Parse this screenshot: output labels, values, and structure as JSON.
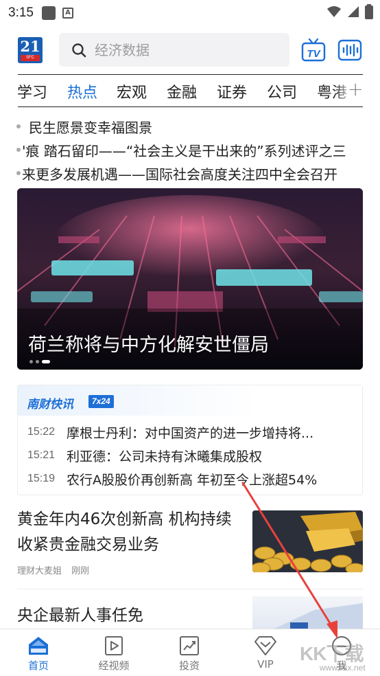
{
  "status_bar": {
    "time": "3:15"
  },
  "header": {
    "logo_number": "21",
    "logo_sub": "SFC",
    "search_placeholder": "经济数据"
  },
  "tabs": [
    "学习",
    "热点",
    "宏观",
    "金融",
    "证券",
    "公司",
    "粤港"
  ],
  "active_tab": "热点",
  "ticker": [
    "民生愿景变幸福图景",
    "'痕 踏石留印——“社会主义是干出来的”系列述评之三",
    "来更多发展机遇——国际社会高度关注四中全会召开"
  ],
  "banner": {
    "caption": "荷兰称将与中方化解安世僵局",
    "slide_count": 3,
    "active_slide": 3
  },
  "express": {
    "title": "南财快讯",
    "badge": "7x24",
    "items": [
      {
        "time": "15:22",
        "text": "摩根士丹利：对中国资产的进一步增持将..."
      },
      {
        "time": "15:21",
        "text": "利亚德：公司未持有沐曦集成股权"
      },
      {
        "time": "15:19",
        "text": "农行A股股价再创新高 年初至今上涨超54%"
      }
    ]
  },
  "article1": {
    "title": "黄金年内46次创新高 机构持续收紧贵金融交易业务",
    "source": "理财大麦姐",
    "time": "刚刚"
  },
  "article2": {
    "title": "央企最新人事任免"
  },
  "bottom_nav": [
    {
      "label": "首页",
      "icon": "home-icon",
      "active": true
    },
    {
      "label": "经视频",
      "icon": "video-play-icon",
      "active": false
    },
    {
      "label": "投资",
      "icon": "chart-trend-icon",
      "active": false
    },
    {
      "label": "VIP",
      "icon": "vip-diamond-icon",
      "active": false
    },
    {
      "label": "我",
      "icon": "user-icon",
      "active": false
    }
  ],
  "watermark": {
    "text": "KK下载",
    "url": "www.kkx.net"
  },
  "colors": {
    "accent": "#1a6fd6",
    "logo_blue": "#1a5fb4",
    "logo_red": "#d42a2a",
    "arrow": "#e8413c"
  }
}
